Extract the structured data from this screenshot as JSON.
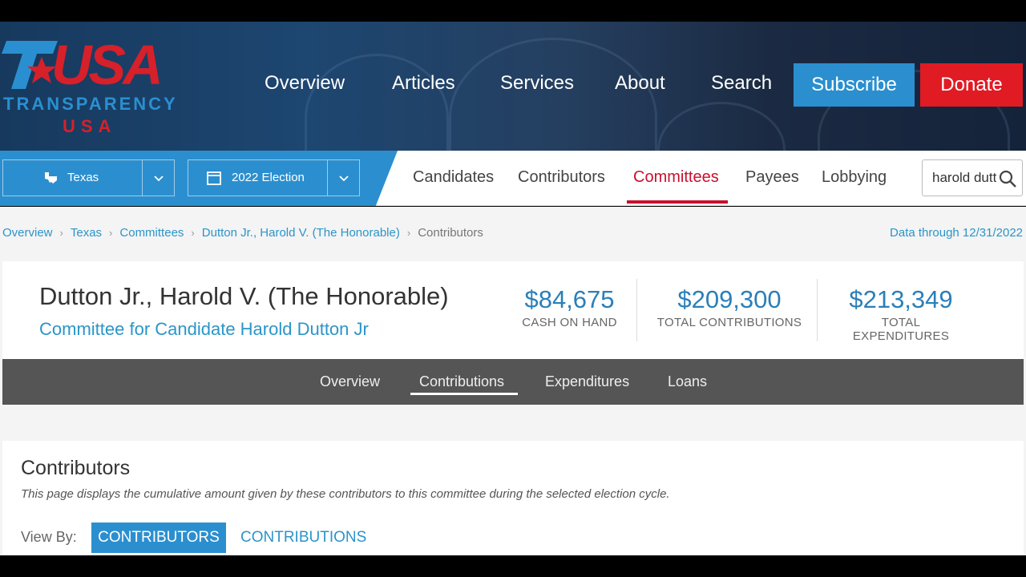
{
  "brand": {
    "logo_top": "USA",
    "logo_middle": "TRANSPARENCY",
    "logo_bottom": "USA"
  },
  "main_nav": {
    "items": [
      "Overview",
      "Articles",
      "Services",
      "About",
      "Search"
    ],
    "subscribe": "Subscribe",
    "donate": "Donate"
  },
  "filters": {
    "state": "Texas",
    "election": "2022 Election"
  },
  "sub_nav": {
    "items": [
      "Candidates",
      "Contributors",
      "Committees",
      "Payees",
      "Lobbying"
    ],
    "active": "Committees"
  },
  "search": {
    "value": "harold dutton"
  },
  "breadcrumb": {
    "items": [
      "Overview",
      "Texas",
      "Committees",
      "Dutton Jr., Harold V. (The Honorable)"
    ],
    "current": "Contributors"
  },
  "data_through": "Data through 12/31/2022",
  "candidate": {
    "name": "Dutton Jr., Harold V. (The Honorable)",
    "committee": "Committee for Candidate Harold Dutton Jr"
  },
  "stats": [
    {
      "value": "$84,675",
      "label": "CASH ON HAND"
    },
    {
      "value": "$209,300",
      "label": "TOTAL CONTRIBUTIONS"
    },
    {
      "value": "$213,349",
      "label": "TOTAL EXPENDITURES"
    }
  ],
  "tabs": {
    "items": [
      "Overview",
      "Contributions",
      "Expenditures",
      "Loans"
    ],
    "active": "Contributions"
  },
  "contributors_section": {
    "title": "Contributors",
    "description": "This page displays the cumulative amount given by these contributors to this committee during the selected election cycle.",
    "view_by_label": "View By:",
    "view_options": [
      "CONTRIBUTORS",
      "CONTRIBUTIONS"
    ],
    "active_view": "CONTRIBUTORS"
  },
  "colors": {
    "brand_blue": "#2b8fcf",
    "brand_red": "#e01b24",
    "active_red": "#c8102e",
    "link_blue": "#2b95c9",
    "tab_bar": "#555555"
  }
}
